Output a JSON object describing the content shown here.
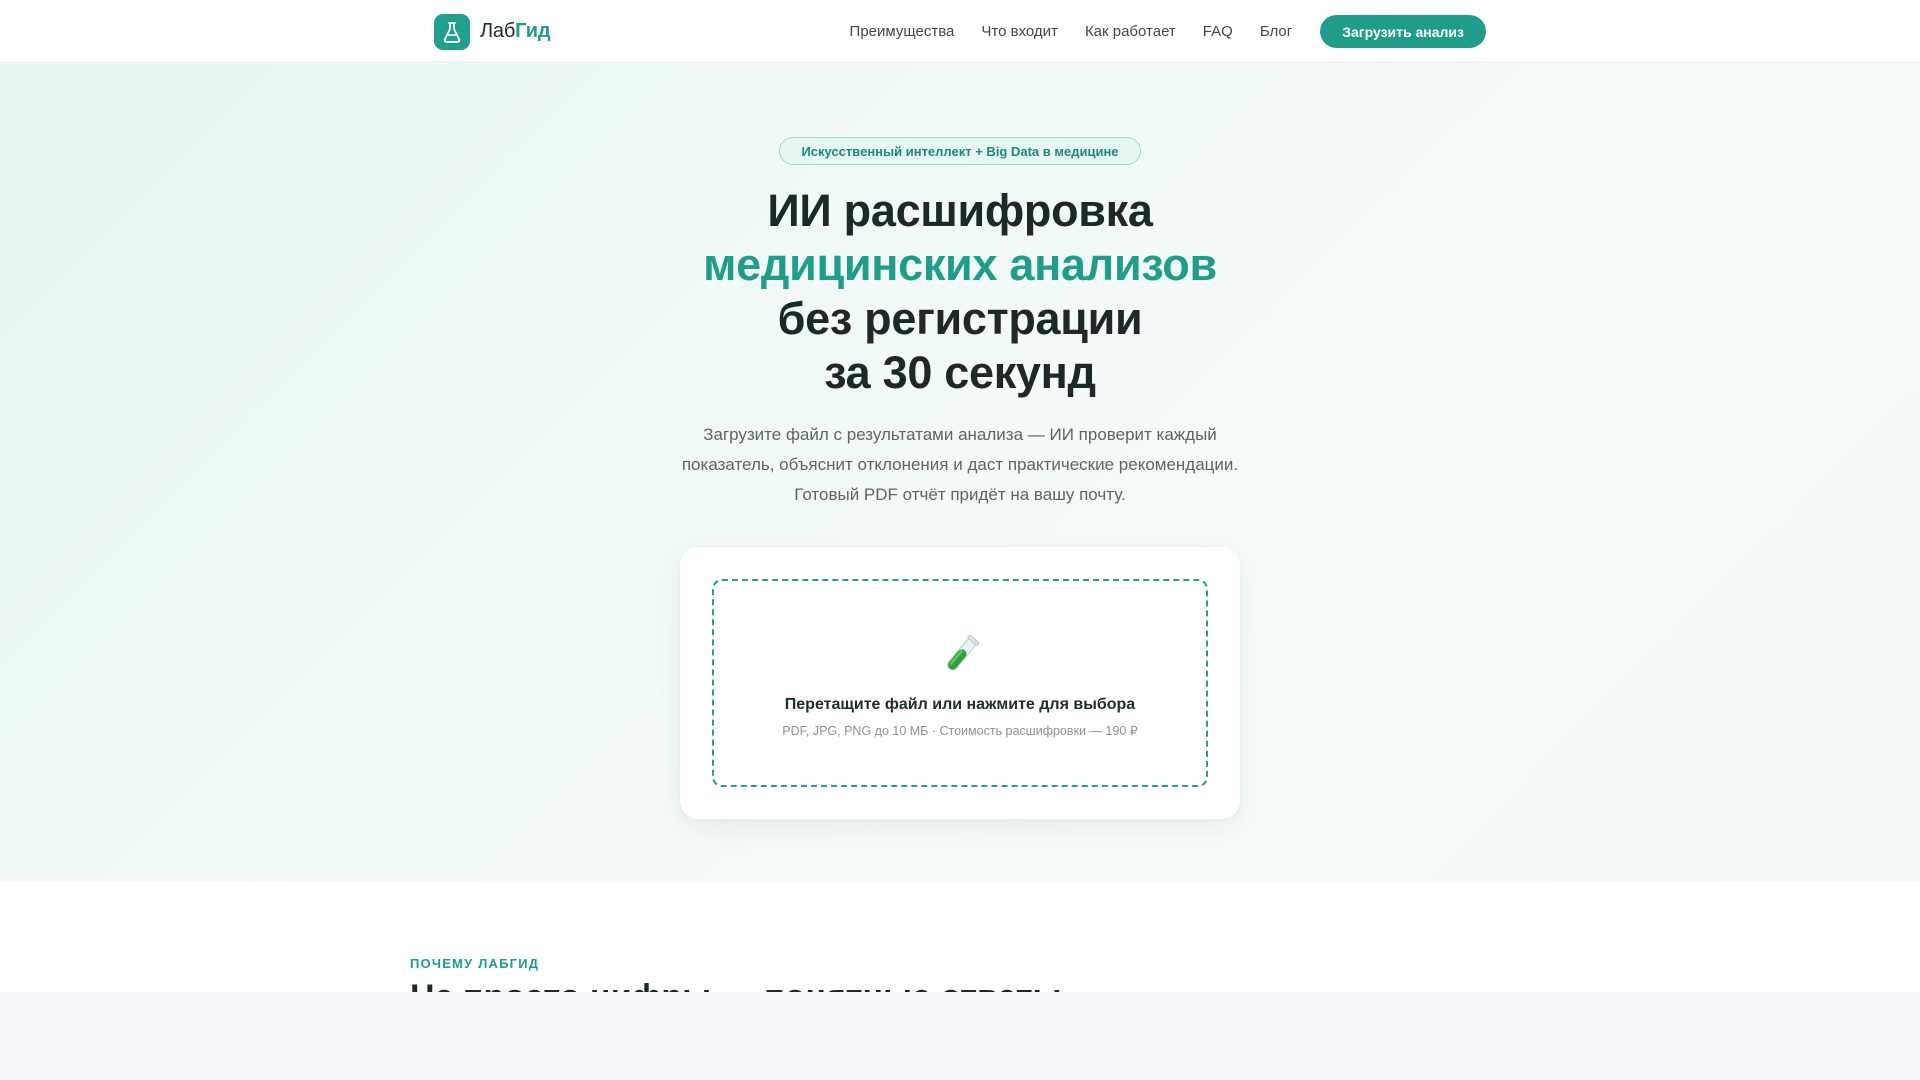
{
  "brand": {
    "name_part1": "Лаб",
    "name_part2": "Гид",
    "logo_icon": "flask-icon"
  },
  "nav": {
    "items": [
      "Преимущества",
      "Что входит",
      "Как работает",
      "FAQ",
      "Блог"
    ],
    "cta_label": "Загрузить анализ"
  },
  "hero": {
    "badge": "Искусственный интеллект + Big Data в медицине",
    "title_line1": "ИИ расшифровка",
    "title_line2": "медицинских анализов",
    "title_line3": "без регистрации",
    "title_line4": "за 30 секунд",
    "subtitle_line1": "Загрузите файл с результатами анализа — ИИ проверит каждый",
    "subtitle_line2": "показатель, объяснит отклонения и даст практические рекомендации.",
    "subtitle_line3": "Готовый PDF отчёт придёт на вашу почту."
  },
  "upload": {
    "icon": "test-tube-icon",
    "title": "Перетащите файл или нажмите для выбора",
    "hint": "PDF, JPG, PNG до 10 МБ · Стоимость расшифровки — 190 ₽"
  },
  "section": {
    "eyebrow": "ПОЧЕМУ ЛАБГИД",
    "title": "Не просто цифры — понятные ответы"
  },
  "colors": {
    "accent": "#1f9c8a",
    "text_dark": "#1b2a28",
    "text_muted": "#5a6664"
  }
}
